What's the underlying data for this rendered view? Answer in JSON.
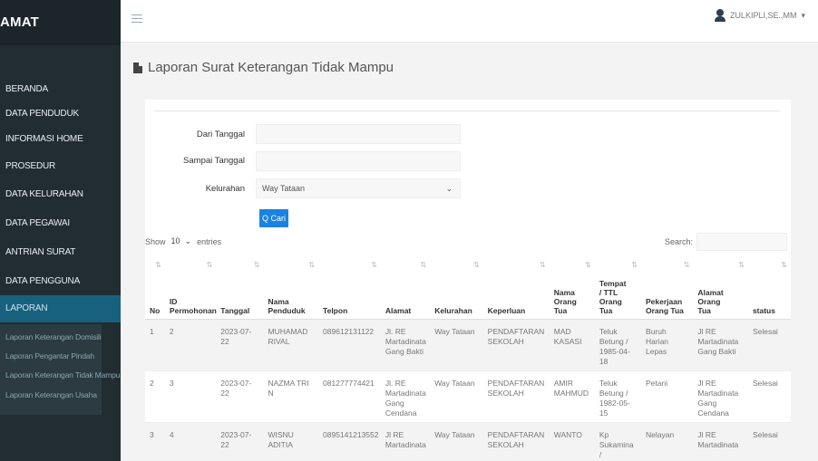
{
  "app": {
    "brand": "AMAT"
  },
  "sidebar": {
    "items": [
      {
        "label": "BERANDA"
      },
      {
        "label": "DATA PENDUDUK"
      },
      {
        "label": "INFORMASI HOME"
      },
      {
        "label": "PROSEDUR"
      },
      {
        "label": "DATA KELURAHAN"
      },
      {
        "label": "DATA PEGAWAI"
      },
      {
        "label": "ANTRIAN SURAT"
      },
      {
        "label": "DATA PENGGUNA"
      },
      {
        "label": "LAPORAN"
      }
    ],
    "submenu": [
      {
        "label": "Laporan Keterangan Domisili"
      },
      {
        "label": "Laporan Pengantar Pindah"
      },
      {
        "label": "Laporan Keterangan Tidak Mampu"
      },
      {
        "label": "Laporan Keterangan Usaha"
      }
    ]
  },
  "topbar": {
    "user": "ZULKIPLI,SE.,MM",
    "caret": "▾",
    "user_icon": "user-icon"
  },
  "page": {
    "title": "Laporan Surat Keterangan Tidak Mampu"
  },
  "filter": {
    "dari_label": "Dari Tanggal",
    "dari_value": "",
    "sampai_label": "Sampai Tanggal",
    "sampai_value": "",
    "kelurahan_label": "Kelurahan",
    "kelurahan_value": "Way Tataan",
    "search_button": "Q Cari"
  },
  "table_controls": {
    "show_label": "Show",
    "entries_value": "10",
    "entries_label": "entries",
    "search_label": "Search:",
    "search_value": ""
  },
  "table": {
    "columns": [
      [
        "No"
      ],
      [
        "ID",
        "Permohonan"
      ],
      [
        "Tanggal"
      ],
      [
        "Nama",
        "Penduduk"
      ],
      [
        "Telpon"
      ],
      [
        "Alamat"
      ],
      [
        "Kelurahan"
      ],
      [
        "Keperluan"
      ],
      [
        "Nama",
        "Orang",
        "Tua"
      ],
      [
        "Tempat",
        "/ TTL",
        "Orang",
        "Tua"
      ],
      [
        "Pekerjaan",
        "Orang Tua"
      ],
      [
        "Alamat",
        "Orang",
        "Tua"
      ],
      [
        "status"
      ]
    ],
    "rows": [
      {
        "cells": [
          [
            "1"
          ],
          [
            "2"
          ],
          [
            "2023-07-22"
          ],
          [
            "MUHAMAD",
            "RIVAL"
          ],
          [
            "089612131122"
          ],
          [
            "Jl. RE",
            "Martadinata",
            "Gang Bakti"
          ],
          [
            "Way Tataan"
          ],
          [
            "PENDAFTARAN",
            "SEKOLAH"
          ],
          [
            "MAD",
            "KASASI"
          ],
          [
            "Teluk",
            "Betung /",
            "1985-04-",
            "18"
          ],
          [
            "Buruh Harian",
            "Lepas"
          ],
          [
            "Jl RE",
            "Martadinata",
            "Gang Bakti"
          ],
          [
            "Selesai"
          ]
        ]
      },
      {
        "cells": [
          [
            "2"
          ],
          [
            "3"
          ],
          [
            "2023-07-22"
          ],
          [
            "NAZMA TRI N"
          ],
          [
            "081277774421"
          ],
          [
            "Jl. RE",
            "Martadinata",
            "Gang",
            "Cendana"
          ],
          [
            "Way Tataan"
          ],
          [
            "PENDAFTARAN",
            "SEKOLAH"
          ],
          [
            "AMIR",
            "MAHMUD"
          ],
          [
            "Teluk",
            "Betung /",
            "1982-05-",
            "15"
          ],
          [
            "Petani"
          ],
          [
            "Jl RE",
            "Martadinata",
            "Gang",
            "Cendana"
          ],
          [
            "Selesai"
          ]
        ]
      },
      {
        "cells": [
          [
            "3"
          ],
          [
            "4"
          ],
          [
            "2023-07-22"
          ],
          [
            "WISNU",
            "ADITIA"
          ],
          [
            "0895141213552"
          ],
          [
            "Jl RE",
            "Martadinata"
          ],
          [
            "Way Tataan"
          ],
          [
            "PENDAFTARAN",
            "SEKOLAH"
          ],
          [
            "WANTO"
          ],
          [
            "Kp",
            "Sukamina /"
          ],
          [
            "Nelayan"
          ],
          [
            "Jl RE",
            "Martadinata"
          ],
          [
            "Selesai"
          ]
        ]
      }
    ]
  },
  "colors": {
    "sidebar_bg": "#222d32",
    "active_bg": "#17617f",
    "button_bg": "#1a82e2"
  }
}
